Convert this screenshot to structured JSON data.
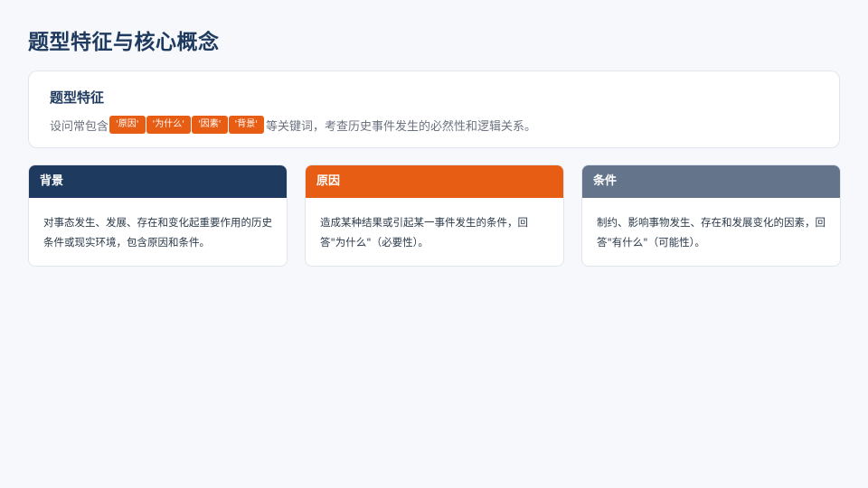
{
  "page_title": "题型特征与核心概念",
  "feature": {
    "heading": "题型特征",
    "text_before": "设问常包含",
    "keywords": [
      "'原因'",
      "'为什么'",
      "'因素'",
      "'背景'"
    ],
    "text_after": "等关键词，考查历史事件发生的必然性和逻辑关系。"
  },
  "cards": [
    {
      "title": "背景",
      "body": "对事态发生、发展、存在和变化起重要作用的历史条件或现实环境，包含原因和条件。",
      "header_color": "#1f3a5f"
    },
    {
      "title": "原因",
      "body": "造成某种结果或引起某一事件发生的条件，回答\"为什么\"（必要性）。",
      "header_color": "#e85d14"
    },
    {
      "title": "条件",
      "body": "制约、影响事物发生、存在和发展变化的因素，回答\"有什么\"（可能性）。",
      "header_color": "#64748b"
    }
  ]
}
